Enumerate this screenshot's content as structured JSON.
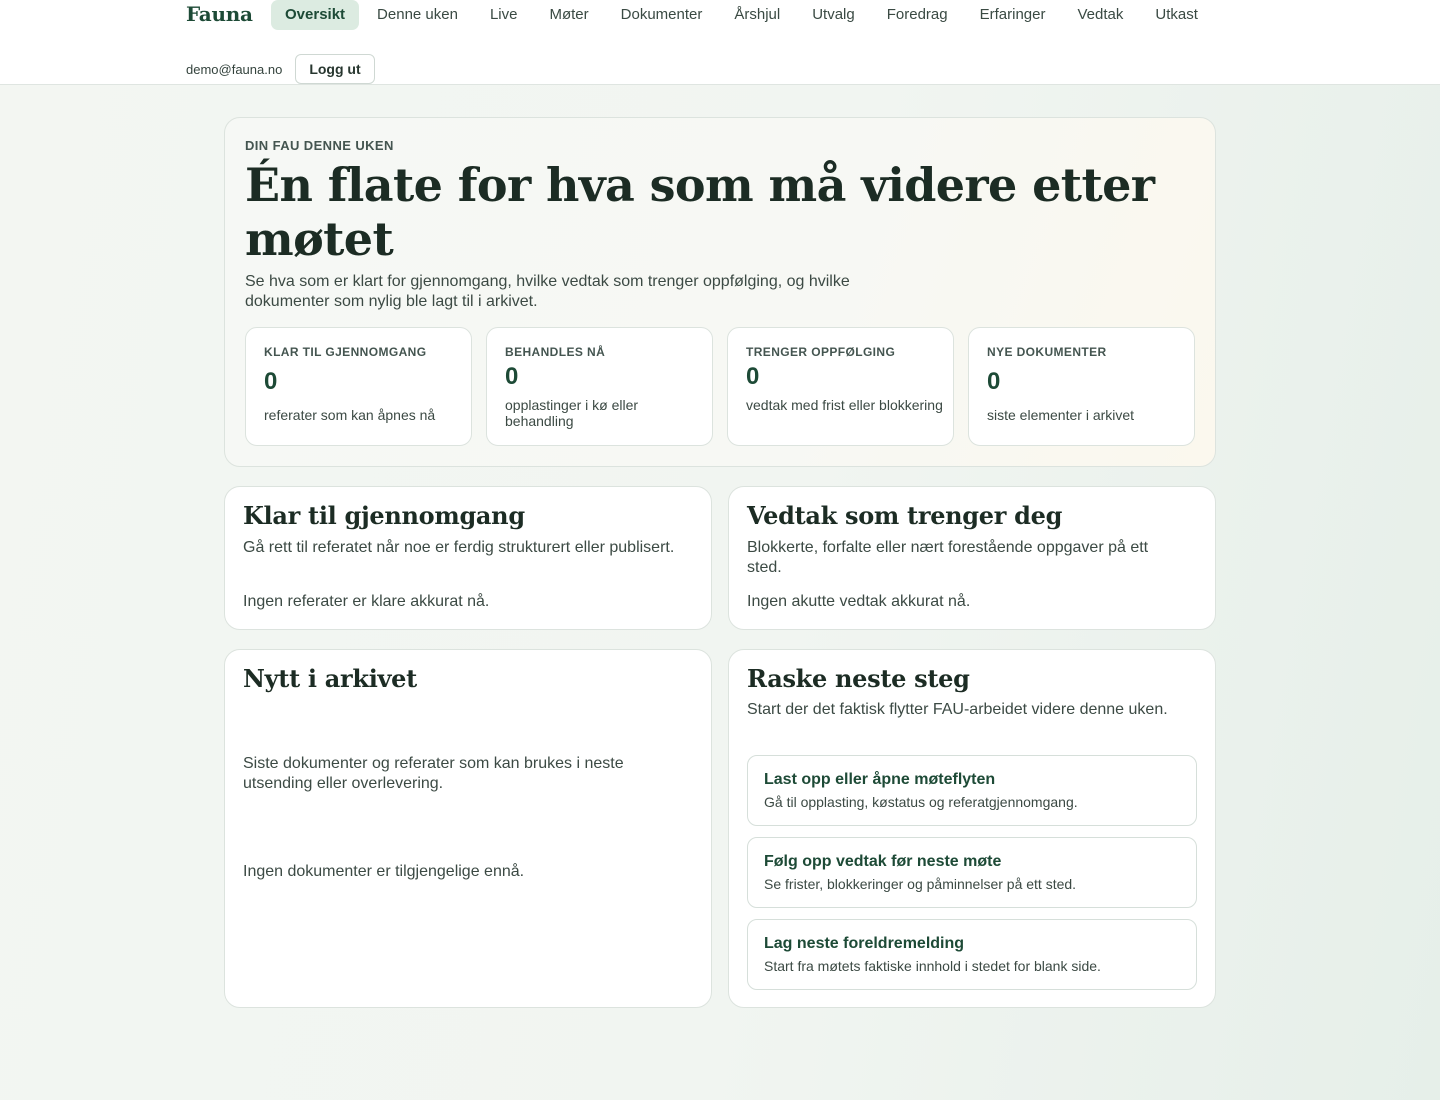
{
  "app": {
    "brand": "Fauna"
  },
  "nav": {
    "items": [
      {
        "label": "Oversikt",
        "active": true
      },
      {
        "label": "Denne uken"
      },
      {
        "label": "Live"
      },
      {
        "label": "Møter"
      },
      {
        "label": "Dokumenter"
      },
      {
        "label": "Årshjul"
      },
      {
        "label": "Utvalg"
      },
      {
        "label": "Foredrag"
      },
      {
        "label": "Erfaringer"
      },
      {
        "label": "Vedtak"
      },
      {
        "label": "Utkast"
      }
    ]
  },
  "user": {
    "email": "demo@fauna.no",
    "logout_label": "Logg ut"
  },
  "hero": {
    "eyebrow": "DIN FAU DENNE UKEN",
    "title": "Én flate for hva som må videre etter møtet",
    "subtitle": "Se hva som er klart for gjennomgang, hvilke vedtak som trenger oppfølging, og hvilke dokumenter som nylig ble lagt til i arkivet.",
    "stats": [
      {
        "label": "KLAR TIL GJENNOMGANG",
        "value": "0",
        "desc": "referater som kan åpnes nå"
      },
      {
        "label": "BEHANDLES NÅ",
        "value": "0",
        "desc": "opplastinger i kø eller behandling"
      },
      {
        "label": "TRENGER OPPFØLGING",
        "value": "0",
        "desc": "vedtak med frist eller blokkering"
      },
      {
        "label": "NYE DOKUMENTER",
        "value": "0",
        "desc": "siste elementer i arkivet"
      }
    ]
  },
  "review_card": {
    "title": "Klar til gjennomgang",
    "desc": "Gå rett til referatet når noe er ferdig strukturert eller publisert.",
    "empty": "Ingen referater er klare akkurat nå."
  },
  "decisions_card": {
    "title": "Vedtak som trenger deg",
    "desc": "Blokkerte, forfalte eller nært forestående oppgaver på ett sted.",
    "empty": "Ingen akutte vedtak akkurat nå."
  },
  "archive_card": {
    "title": "Nytt i arkivet",
    "desc": "Siste dokumenter og referater som kan brukes i neste utsending eller overlevering.",
    "empty": "Ingen dokumenter er tilgjengelige ennå."
  },
  "next_steps_card": {
    "title": "Raske neste steg",
    "desc": "Start der det faktisk flytter FAU-arbeidet videre denne uken.",
    "steps": [
      {
        "title": "Last opp eller åpne møteflyten",
        "desc": "Gå til opplasting, køstatus og referatgjennomgang."
      },
      {
        "title": "Følg opp vedtak før neste møte",
        "desc": "Se frister, blokkeringer og påminnelser på ett sted."
      },
      {
        "title": "Lag neste foreldremelding",
        "desc": "Start fra møtets faktiske innhold i stedet for blank side."
      }
    ]
  }
}
